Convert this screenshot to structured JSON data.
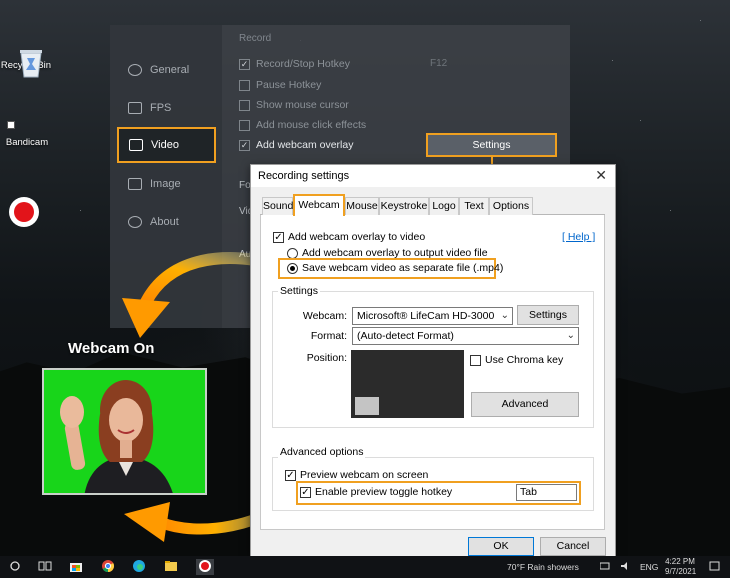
{
  "desktop": {
    "icons": [
      {
        "label": "Recycle Bin",
        "icon": "recycle-bin-icon"
      },
      {
        "label": "Bandicam",
        "icon": "bandicam-record-icon"
      }
    ]
  },
  "bandicam": {
    "sidebar": [
      {
        "label": "General",
        "icon": "gear-icon"
      },
      {
        "label": "FPS",
        "icon": "fps-icon"
      },
      {
        "label": "Video",
        "icon": "video-icon",
        "active": true
      },
      {
        "label": "Image",
        "icon": "image-icon"
      },
      {
        "label": "About",
        "icon": "info-icon"
      }
    ],
    "record_heading": "Record",
    "options": [
      {
        "label": "Record/Stop Hotkey",
        "checked": true
      },
      {
        "label": "Pause Hotkey",
        "checked": false
      },
      {
        "label": "Show mouse cursor",
        "checked": false
      },
      {
        "label": "Add mouse click effects",
        "checked": false
      },
      {
        "label": "Add webcam overlay",
        "checked": true
      }
    ],
    "hotkey_value": "F12",
    "truncated_labels": [
      "Fo",
      "Vid",
      "Au"
    ],
    "settings_button": "Settings"
  },
  "webcam_preview": {
    "label": "Webcam On"
  },
  "dialog": {
    "title": "Recording settings",
    "close_glyph": "✕",
    "tabs": [
      "Sound",
      "Webcam",
      "Mouse",
      "Keystroke",
      "Logo",
      "Text",
      "Options"
    ],
    "active_tab": "Webcam",
    "add_overlay_label": "Add webcam overlay to video",
    "add_overlay_checked": true,
    "help_link": "[ Help ]",
    "radio_output": "Add webcam overlay to output video file",
    "radio_separate": "Save webcam video as separate file (.mp4)",
    "selected_radio": "separate",
    "settings_group": "Settings",
    "webcam_label": "Webcam:",
    "webcam_value": "Microsoft® LifeCam HD-3000",
    "webcam_settings_button": "Settings",
    "format_label": "Format:",
    "format_value": "(Auto-detect Format)",
    "position_label": "Position:",
    "chroma_label": "Use Chroma key",
    "chroma_checked": false,
    "advanced_button": "Advanced",
    "advanced_group": "Advanced options",
    "preview_label": "Preview webcam on screen",
    "preview_checked": true,
    "hotkey_label": "Enable preview toggle hotkey",
    "hotkey_checked": true,
    "hotkey_value": "Tab",
    "ok_button": "OK",
    "cancel_button": "Cancel"
  },
  "taskbar": {
    "weather": "70°F  Rain showers",
    "language": "ENG",
    "time": "4:22 PM",
    "date": "9/7/2021"
  },
  "colors": {
    "highlight": "#f0a020",
    "chroma_green": "#18d51a",
    "record_red": "#e2141a"
  }
}
